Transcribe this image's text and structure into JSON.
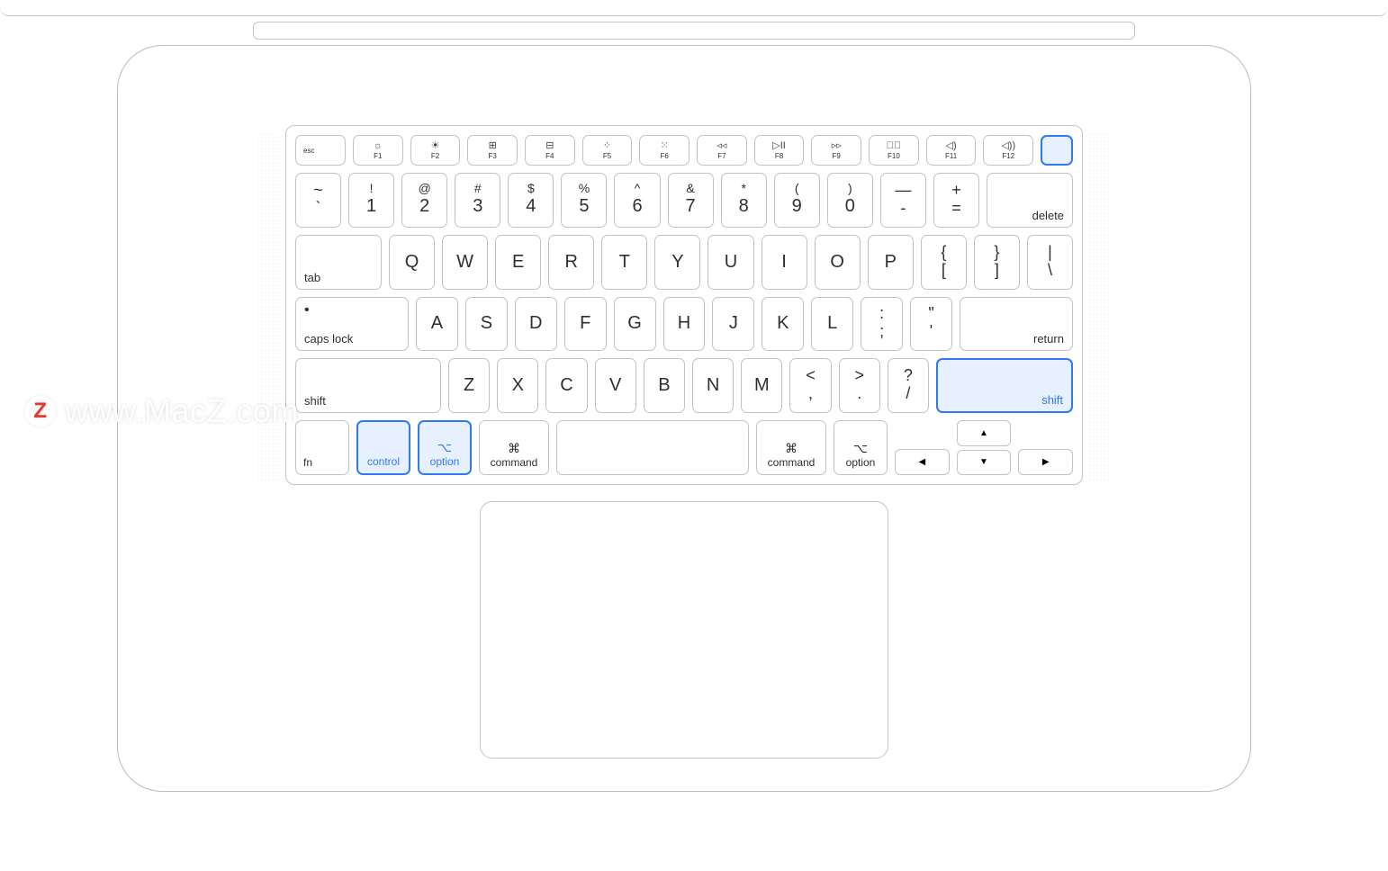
{
  "watermark": {
    "z": "Z",
    "text": "www.MacZ.com"
  },
  "fn_row": {
    "esc": "esc",
    "keys": [
      {
        "icon": "☼",
        "label": "F1"
      },
      {
        "icon": "☀",
        "label": "F2"
      },
      {
        "icon": "⊞",
        "label": "F3"
      },
      {
        "icon": "⊟",
        "label": "F4"
      },
      {
        "icon": "⁘",
        "label": "F5"
      },
      {
        "icon": "⁙",
        "label": "F6"
      },
      {
        "icon": "◃◃",
        "label": "F7"
      },
      {
        "icon": "▷II",
        "label": "F8"
      },
      {
        "icon": "▹▹",
        "label": "F9"
      },
      {
        "icon": "◁⃠",
        "label": "F10"
      },
      {
        "icon": "◁)",
        "label": "F11"
      },
      {
        "icon": "◁))",
        "label": "F12"
      }
    ],
    "power": ""
  },
  "num_row": {
    "keys": [
      {
        "top": "~",
        "bot": "`"
      },
      {
        "top": "!",
        "bot": "1"
      },
      {
        "top": "@",
        "bot": "2"
      },
      {
        "top": "#",
        "bot": "3"
      },
      {
        "top": "$",
        "bot": "4"
      },
      {
        "top": "%",
        "bot": "5"
      },
      {
        "top": "^",
        "bot": "6"
      },
      {
        "top": "&",
        "bot": "7"
      },
      {
        "top": "*",
        "bot": "8"
      },
      {
        "top": "(",
        "bot": "9"
      },
      {
        "top": ")",
        "bot": "0"
      },
      {
        "top": "—",
        "bot": "-"
      },
      {
        "top": "+",
        "bot": "="
      }
    ],
    "delete": "delete"
  },
  "row_q": {
    "tab": "tab",
    "letters": [
      "Q",
      "W",
      "E",
      "R",
      "T",
      "Y",
      "U",
      "I",
      "O",
      "P"
    ],
    "brackets": [
      {
        "top": "{",
        "bot": "["
      },
      {
        "top": "}",
        "bot": "]"
      },
      {
        "top": "|",
        "bot": "\\"
      }
    ]
  },
  "row_a": {
    "caps": "caps lock",
    "letters": [
      "A",
      "S",
      "D",
      "F",
      "G",
      "H",
      "J",
      "K",
      "L"
    ],
    "punct": [
      {
        "top": ":",
        "bot": ";"
      },
      {
        "top": "\"",
        "bot": "'"
      }
    ],
    "return": "return"
  },
  "row_z": {
    "shift_l": "shift",
    "letters": [
      "Z",
      "X",
      "C",
      "V",
      "B",
      "N",
      "M"
    ],
    "punct": [
      {
        "top": "<",
        "bot": ","
      },
      {
        "top": ">",
        "bot": "."
      },
      {
        "top": "?",
        "bot": "/"
      }
    ],
    "shift_r": "shift"
  },
  "row_mod": {
    "fn": "fn",
    "control": "control",
    "option_l": "option",
    "command_l": "command",
    "command_r": "command",
    "option_r": "option",
    "option_icon": "⌥",
    "command_icon": "⌘",
    "arrows": {
      "up": "▲",
      "down": "▼",
      "left": "◀",
      "right": "▶"
    }
  },
  "highlighted_keys": [
    "control",
    "option-left",
    "shift-right",
    "power"
  ]
}
